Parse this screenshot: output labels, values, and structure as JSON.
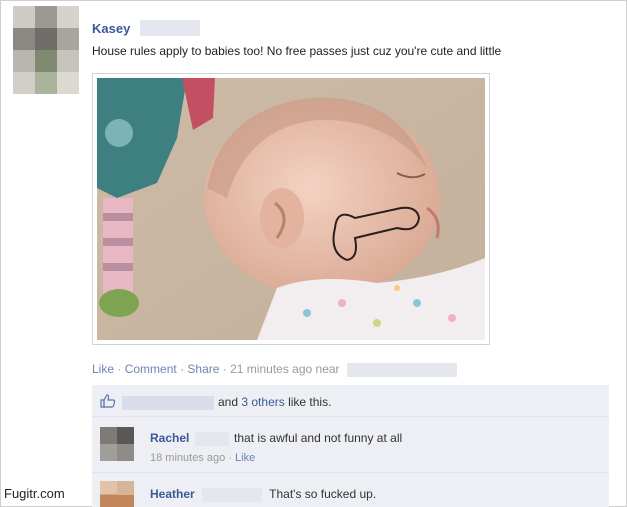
{
  "post": {
    "author": "Kasey",
    "status_text": "House rules apply to babies too! No free passes just cuz you're cute and little",
    "photo_alt": "",
    "actions": {
      "like": "Like",
      "comment": "Comment",
      "share": "Share",
      "time": "21 minutes ago near"
    }
  },
  "likes": {
    "and_text": "and",
    "others_link": "3 others",
    "suffix": "like this."
  },
  "comments": [
    {
      "name": "Rachel",
      "text": "that is awful and not funny at all",
      "time": "18 minutes ago",
      "like": "Like"
    },
    {
      "name": "Heather",
      "text": "That's so fucked up."
    }
  ],
  "watermark": "Fugitr.com",
  "colors": {
    "link": "#3b5998",
    "muted_link": "#6d84b4",
    "feedback_bg": "#edeff4"
  }
}
